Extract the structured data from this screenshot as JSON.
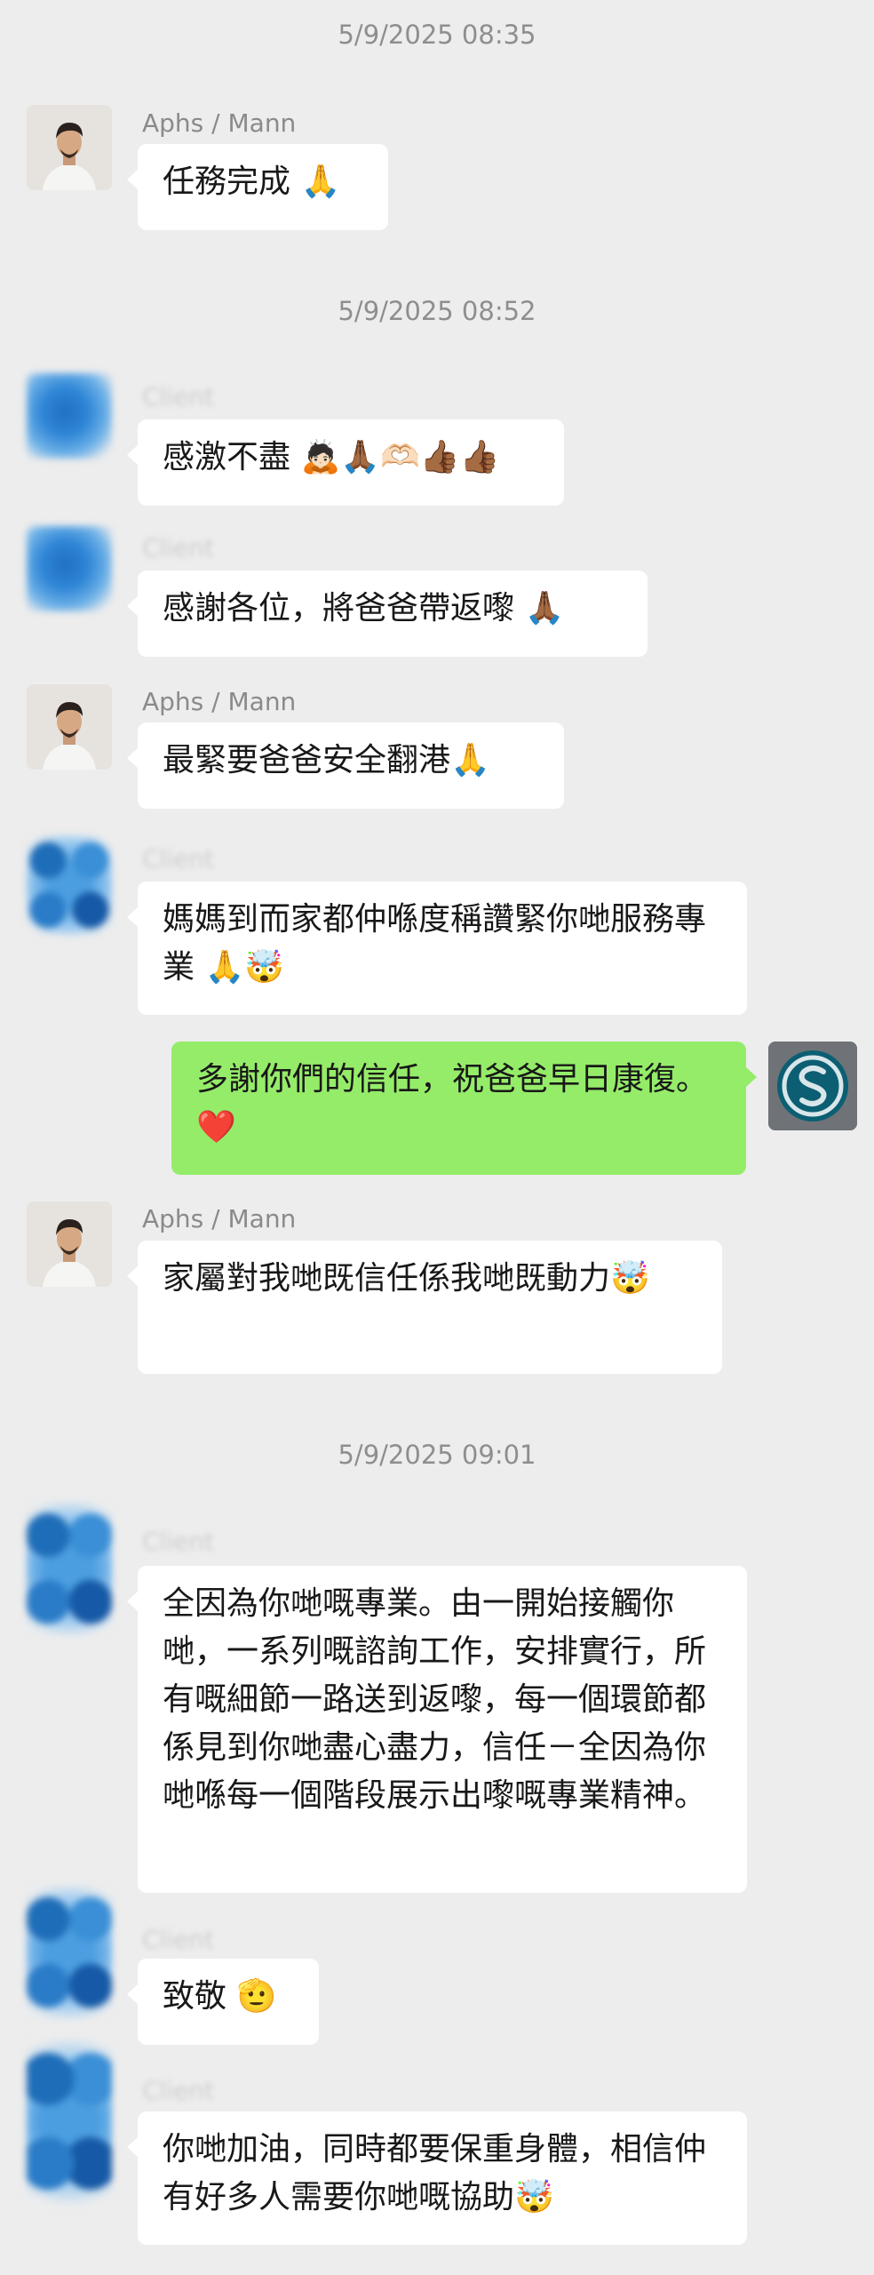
{
  "timestamps": [
    "5/9/2025 08:35",
    "5/9/2025 08:52",
    "5/9/2025 09:01"
  ],
  "messages": [
    {
      "sender": "Aphs / Mann",
      "text": "任務完成 🙏"
    },
    {
      "sender": "Client",
      "text": "感激不盡 🙇🏻🙏🏾🫶🏻👍🏾👍🏾"
    },
    {
      "sender": "Client",
      "text": "感謝各位，將爸爸帶返嚟 🙏🏾"
    },
    {
      "sender": "Aphs / Mann",
      "text": "最緊要爸爸安全翻港🙏"
    },
    {
      "sender": "Client",
      "text": "媽媽到而家都仲喺度稱讚緊你哋服務專業 🙏🤯"
    },
    {
      "sender": "Me",
      "text": "多謝你們的信任，祝爸爸早日康復。❤️"
    },
    {
      "sender": "Aphs / Mann",
      "text": "家屬對我哋既信任係我哋既動力🤯"
    },
    {
      "sender": "Client",
      "text": "全因為你哋嘅專業。由一開始接觸你哋，一系列嘅諮詢工作，安排實行，所有嘅細節一路送到返嚟，每一個環節都係見到你哋盡心盡力，信任－全因為你哋喺每一個階段展示出嚟嘅專業精神。"
    },
    {
      "sender": "Client",
      "text": "致敬 🫡"
    },
    {
      "sender": "Client",
      "text": "你哋加油，同時都要保重身體，相信仲有好多人需要你哋嘅協助🤯"
    }
  ],
  "icons": {
    "person_avatar": "avatar-person-icon",
    "my_avatar": "logo-s-icon",
    "heart": "heart-icon"
  },
  "colors": {
    "background": "#ededed",
    "incoming_bubble": "#ffffff",
    "outgoing_bubble": "#95ec69",
    "timestamp": "#8e8e8e",
    "sender_name": "#8a8a8a",
    "heart": "#e8455b"
  }
}
